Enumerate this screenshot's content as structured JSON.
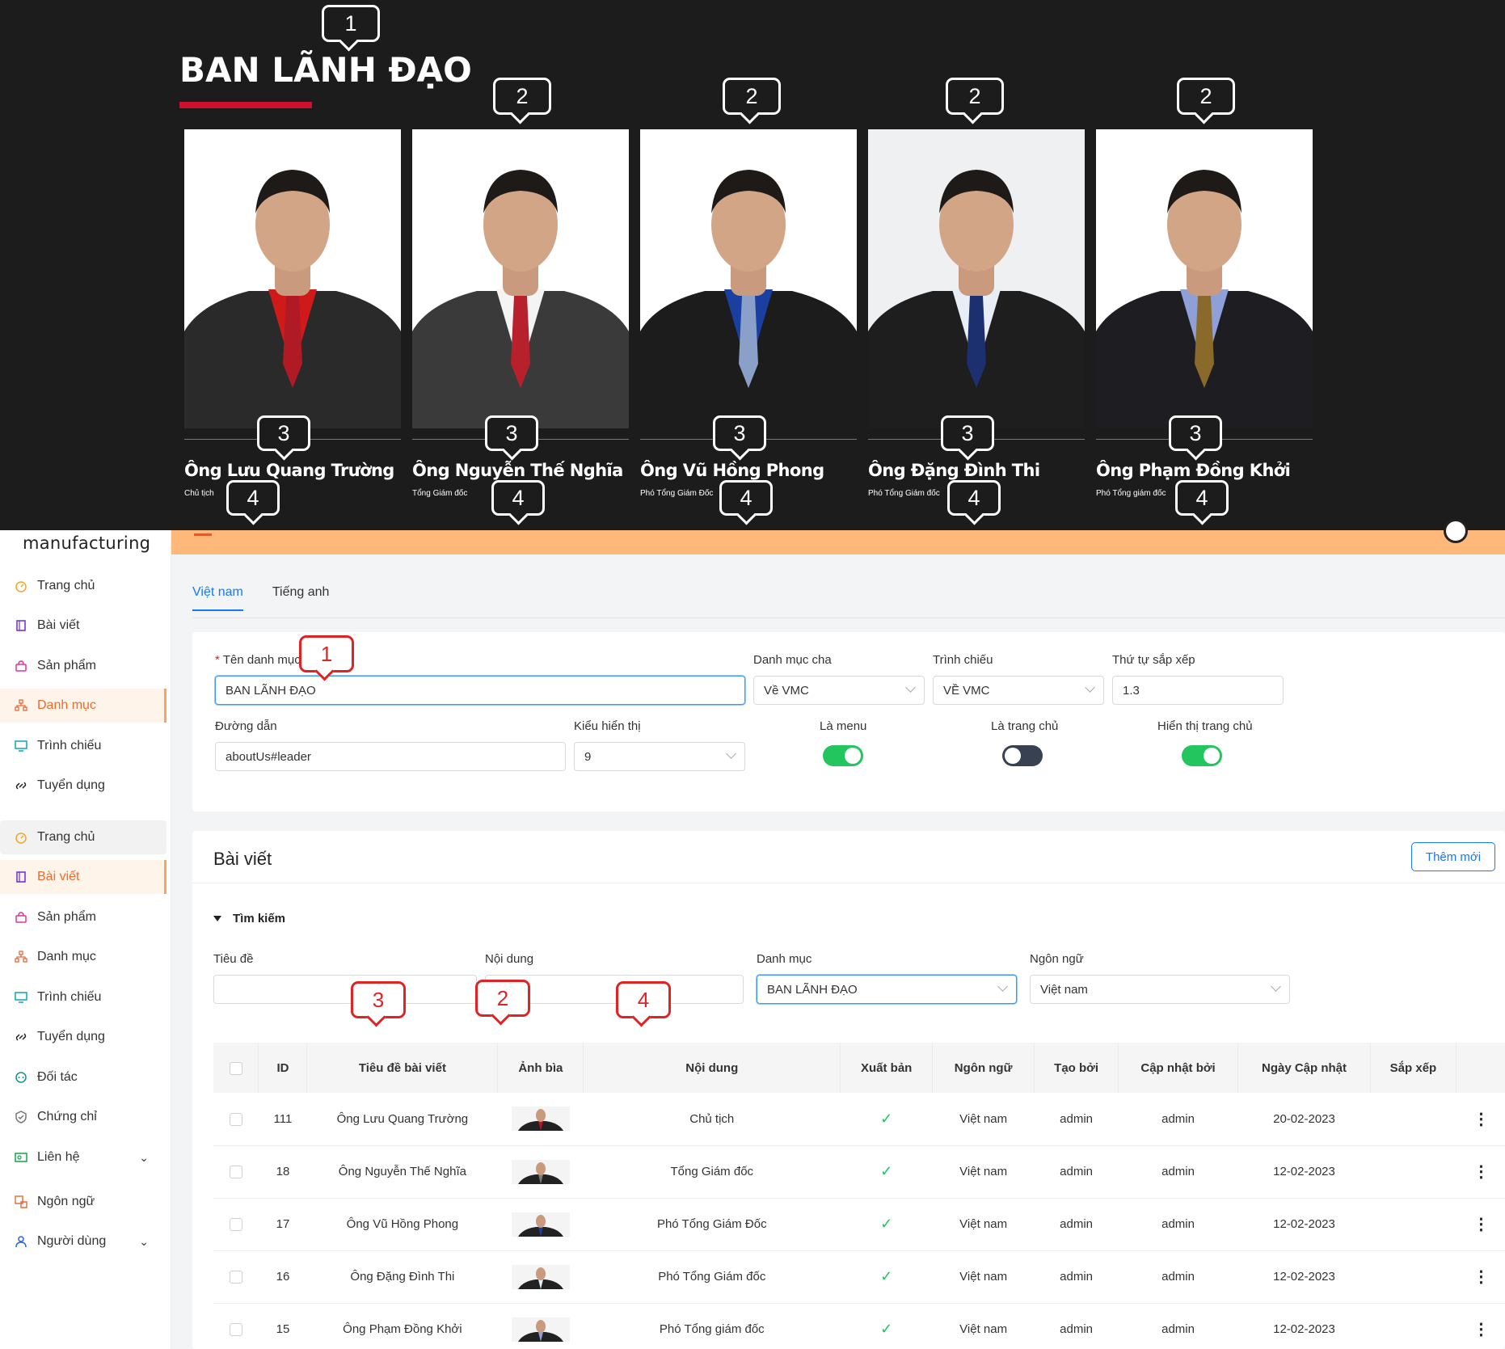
{
  "leaders": {
    "title": "BAN LÃNH ĐẠO",
    "cards": [
      {
        "name": "Ông Lưu Quang Trường",
        "role": "Chủ tịch",
        "tie": "#b01a24",
        "suit": "#2a2a2a",
        "shirt": "#d01a1a",
        "bg": "#ffffff"
      },
      {
        "name": "Ông Nguyễn Thế Nghĩa",
        "role": "Tổng Giám đốc",
        "tie": "#b8202c",
        "suit": "#3a3a3a",
        "shirt": "#f4f4f4",
        "bg": "#ffffff"
      },
      {
        "name": "Ông Vũ Hồng Phong",
        "role": "Phó Tổng Giám Đốc",
        "tie": "#8aa0c8",
        "suit": "#1c1c1c",
        "shirt": "#1a3fa0",
        "bg": "#ffffff"
      },
      {
        "name": "Ông Đặng Đình Thi",
        "role": "Phó Tổng Giám đốc",
        "tie": "#1c2f6e",
        "suit": "#1e1e1e",
        "shirt": "#e8eef6",
        "bg": "#eef0f2"
      },
      {
        "name": "Ông Phạm Đồng Khởi",
        "role": "Phó Tổng giám đốc",
        "tie": "#8a6a2a",
        "suit": "#1e1e22",
        "shirt": "#8fa0d8",
        "bg": "#ffffff"
      }
    ],
    "callouts": {
      "title": "1",
      "photo": "2",
      "name": "3",
      "role": "4"
    }
  },
  "sidebar": {
    "brand": "manufacturing",
    "items": [
      {
        "label": "Trang chủ",
        "icon": "dashboard-icon"
      },
      {
        "label": "Bài viết",
        "icon": "article-icon"
      },
      {
        "label": "Sản phẩm",
        "icon": "bag-icon"
      },
      {
        "label": "Danh mục",
        "icon": "category-icon"
      },
      {
        "label": "Trình chiếu",
        "icon": "monitor-icon"
      },
      {
        "label": "Tuyển dụng",
        "icon": "link-icon"
      },
      {
        "label": "Trang chủ",
        "icon": "dashboard-icon"
      },
      {
        "label": "Bài viết",
        "icon": "article-icon"
      },
      {
        "label": "Sản phẩm",
        "icon": "bag-icon"
      },
      {
        "label": "Danh mục",
        "icon": "category-icon"
      },
      {
        "label": "Trình chiếu",
        "icon": "monitor-icon"
      },
      {
        "label": "Tuyển dụng",
        "icon": "link-icon"
      },
      {
        "label": "Đối tác",
        "icon": "partner-icon"
      },
      {
        "label": "Chứng chỉ",
        "icon": "shield-icon"
      },
      {
        "label": "Liên hệ",
        "icon": "contact-icon"
      },
      {
        "label": "Ngôn ngữ",
        "icon": "translate-icon"
      },
      {
        "label": "Người dùng",
        "icon": "user-icon"
      }
    ]
  },
  "tabs": [
    "Việt nam",
    "Tiếng anh"
  ],
  "form": {
    "name_label": "Tên danh mục",
    "name_value": "BAN LÃNH ĐẠO",
    "parent_label": "Danh mục cha",
    "parent_value": "Về VMC",
    "slide_label": "Trình chiếu",
    "slide_value": "VỀ VMC",
    "order_label": "Thứ tự sắp xếp",
    "order_value": "1.3",
    "path_label": "Đường dẫn",
    "path_value": "aboutUs#leader",
    "display_label": "Kiểu hiển thị",
    "display_value": "9",
    "menu_label": "Là menu",
    "home_label": "Là trang chủ",
    "show_home_label": "Hiển thị trang chủ"
  },
  "posts": {
    "title": "Bài viết",
    "add_label": "Thêm mới",
    "search_label": "Tìm kiếm",
    "filters": {
      "title_label": "Tiêu đề",
      "content_label": "Nội dung",
      "category_label": "Danh mục",
      "category_value": "BAN LÃNH ĐẠO",
      "language_label": "Ngôn ngữ",
      "language_value": "Việt nam"
    },
    "columns": [
      "ID",
      "Tiêu đề bài viết",
      "Ảnh bìa",
      "Nội dung",
      "Xuất bản",
      "Ngôn ngữ",
      "Tạo bởi",
      "Cập nhật bởi",
      "Ngày Cập nhật",
      "Sắp xếp"
    ],
    "rows": [
      {
        "id": "111",
        "title": "Ông Lưu Quang Trường",
        "content": "Chủ tịch",
        "lang": "Việt nam",
        "created": "admin",
        "updated": "admin",
        "date": "20-02-2023"
      },
      {
        "id": "18",
        "title": "Ông Nguyễn Thế Nghĩa",
        "content": "Tổng Giám đốc",
        "lang": "Việt nam",
        "created": "admin",
        "updated": "admin",
        "date": "12-02-2023"
      },
      {
        "id": "17",
        "title": "Ông Vũ Hồng Phong",
        "content": "Phó Tổng Giám Đốc",
        "lang": "Việt nam",
        "created": "admin",
        "updated": "admin",
        "date": "12-02-2023"
      },
      {
        "id": "16",
        "title": "Ông Đặng Đình Thi",
        "content": "Phó Tổng Giám đốc",
        "lang": "Việt nam",
        "created": "admin",
        "updated": "admin",
        "date": "12-02-2023"
      },
      {
        "id": "15",
        "title": "Ông Phạm Đồng Khởi",
        "content": "Phó Tổng giám đốc",
        "lang": "Việt nam",
        "created": "admin",
        "updated": "admin",
        "date": "12-02-2023"
      }
    ]
  },
  "colors": {
    "accent": "#1677ff",
    "brand_orange": "#f06a2c",
    "topbar": "#fdb87a",
    "callout_red": "#e02424",
    "toggle_on": "#22c55e"
  }
}
